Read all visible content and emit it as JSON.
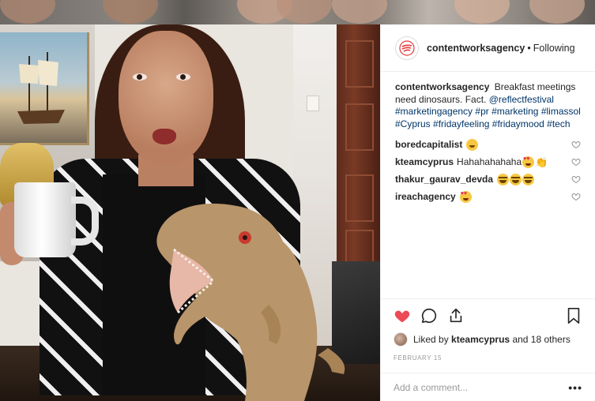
{
  "post": {
    "username": "contentworksagency",
    "separator": "•",
    "follow_status": "Following",
    "caption": {
      "username": "contentworksagency",
      "text": "Breakfast meetings need dinosaurs. Fact.",
      "mention": "@reflectfestival",
      "hashtags": [
        "#marketingagency",
        "#pr",
        "#marketing",
        "#limassol",
        "#Cyprus",
        "#fridayfeeling",
        "#fridaymood",
        "#tech"
      ]
    },
    "comments": [
      {
        "username": "boredcapitalist",
        "text": "",
        "emoji": [
          "grin"
        ]
      },
      {
        "username": "kteamcyprus",
        "text": "Hahahahahaha",
        "emoji": [
          "heart-eyes",
          "clap"
        ]
      },
      {
        "username": "thakur_gaurav_devda",
        "text": "",
        "emoji": [
          "joy",
          "joy",
          "joy"
        ]
      },
      {
        "username": "ireachagency",
        "text": "",
        "emoji": [
          "heart-eyes"
        ]
      }
    ],
    "likes": {
      "prefix": "Liked by",
      "user": "kteamcyprus",
      "suffix": "and 18 others"
    },
    "date": "FEBRUARY 15",
    "add_comment_placeholder": "Add a comment...",
    "more_label": "•••",
    "accent_like_color": "#ed4956"
  }
}
